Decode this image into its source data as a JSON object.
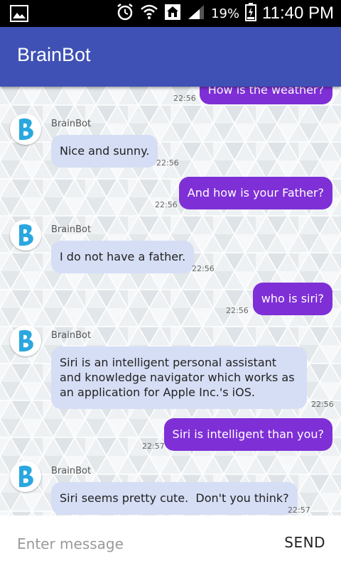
{
  "status_bar": {
    "battery_percent": "19%",
    "time": "11:40 PM",
    "icons": [
      "image-icon",
      "alarm-icon",
      "wifi-icon",
      "home-icon",
      "signal-icon",
      "battery-icon"
    ]
  },
  "app": {
    "title": "BrainBot"
  },
  "colors": {
    "app_bar": "#3f51b5",
    "user_bubble": "#7e2fd6",
    "bot_bubble": "#d6def5"
  },
  "messages": [
    {
      "from": "user",
      "text": "How is the weather?",
      "time": "22:56"
    },
    {
      "from": "bot",
      "sender": "BrainBot",
      "text": "Nice and sunny.",
      "time": "22:56"
    },
    {
      "from": "user",
      "text": "And how is your Father?",
      "time": "22:56"
    },
    {
      "from": "bot",
      "sender": "BrainBot",
      "text": "I do not have a father.",
      "time": "22:56"
    },
    {
      "from": "user",
      "text": "who is siri?",
      "time": "22:56"
    },
    {
      "from": "bot",
      "sender": "BrainBot",
      "text": "Siri is an intelligent personal assistant and knowledge navigator which works as an application for Apple Inc.'s iOS.",
      "time": "22:56"
    },
    {
      "from": "user",
      "text": "Siri is intelligent than you?",
      "time": "22:57"
    },
    {
      "from": "bot",
      "sender": "BrainBot",
      "text": "Siri seems pretty cute.  Don't you think?",
      "time": "22:57"
    }
  ],
  "composer": {
    "placeholder": "Enter message",
    "send_label": "SEND"
  }
}
